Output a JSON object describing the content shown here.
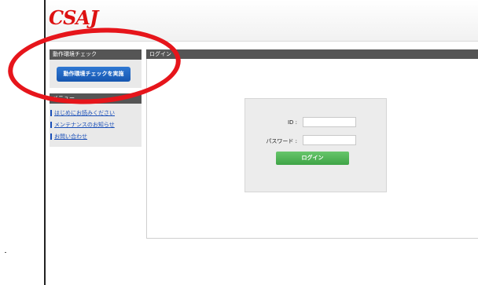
{
  "header": {
    "logo_text": "CSAJ"
  },
  "sidebar": {
    "env_check": {
      "title": "動作環境チェック",
      "button_label": "動作環境チェックを実施"
    },
    "menu": {
      "title": "メニュー",
      "items": [
        {
          "label": "はじめにお読みください"
        },
        {
          "label": "メンテナンスのお知らせ"
        },
        {
          "label": "お問い合わせ"
        }
      ]
    }
  },
  "main": {
    "section_title": "ログイン",
    "login_form": {
      "id_label": "ID :",
      "id_value": "",
      "password_label": "パスワード :",
      "password_value": "",
      "submit_label": "ログイン"
    }
  },
  "annotation": {
    "color": "#e6151b"
  }
}
